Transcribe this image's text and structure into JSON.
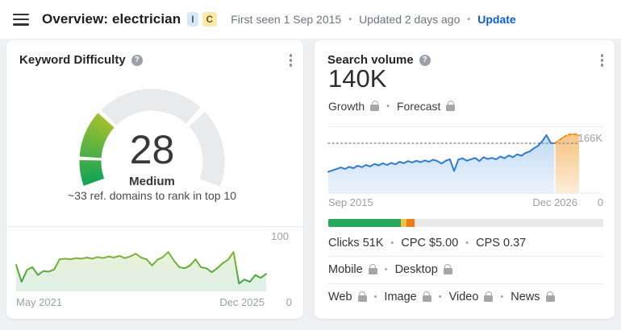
{
  "header": {
    "title": "Overview: electrician",
    "badge_i": "I",
    "badge_c": "C",
    "first_seen": "First seen 1 Sep 2015",
    "updated": "Updated 2 days ago",
    "update_link": "Update",
    "separator": "•"
  },
  "kd_card": {
    "title": "Keyword Difficulty",
    "help_icon": "?",
    "value": "28",
    "label": "Medium",
    "note": "~33 ref. domains to rank in top 10",
    "history": {
      "x_left": "May 2021",
      "x_right": "Dec 2025",
      "y_top": "100",
      "y_bottom": "0"
    }
  },
  "volume_card": {
    "title": "Search volume",
    "help_icon": "?",
    "value": "140K",
    "toggles": [
      {
        "label": "Growth",
        "locked": true
      },
      {
        "label": "Forecast",
        "locked": true
      }
    ],
    "axis": {
      "x_left": "Sep 2015",
      "x_right": "Dec 2026",
      "y_bottom": "0",
      "peak_label": "166K"
    },
    "bar": {
      "track_color": "#e9e9e9",
      "segments": [
        {
          "name": "organic-clicks",
          "color": "#27a65e",
          "pct": 26.4
        },
        {
          "name": "mixed-clicks",
          "color": "#f0c243",
          "pct": 2.0
        },
        {
          "name": "paid-clicks",
          "color": "#ef7d17",
          "pct": 2.9
        }
      ]
    },
    "rows": [
      {
        "name": "clicks-row",
        "items": [
          {
            "label": "Clicks 51K"
          },
          {
            "label": "CPC $5.00"
          },
          {
            "label": "CPS 0.37"
          }
        ]
      },
      {
        "name": "devices-row",
        "items": [
          {
            "label": "Mobile",
            "locked": true
          },
          {
            "label": "Desktop",
            "locked": true
          }
        ]
      },
      {
        "name": "platforms-row",
        "items": [
          {
            "label": "Web",
            "locked": true
          },
          {
            "label": "Image",
            "locked": true
          },
          {
            "label": "Video",
            "locked": true
          },
          {
            "label": "News",
            "locked": true
          }
        ]
      }
    ]
  },
  "chart_data": [
    {
      "id": "kd-gauge",
      "type": "gauge",
      "title": "Keyword Difficulty",
      "value": 28,
      "min": 0,
      "max": 100,
      "label": "Medium",
      "segment_boundaries": [
        10,
        30,
        70
      ],
      "sweep_deg": 220,
      "fill_color_start": "#14a457",
      "fill_color_end": "#a3c02c",
      "track_color": "#e9eaec"
    },
    {
      "id": "kd-history",
      "type": "area",
      "title": "Keyword Difficulty history",
      "x_range": [
        "May 2021",
        "Dec 2025"
      ],
      "ylim": [
        0,
        100
      ],
      "line_color_top": "#a8c12d",
      "line_color_bottom": "#2f9e44",
      "values": [
        47,
        17,
        38,
        43,
        29,
        36,
        35,
        39,
        57,
        58,
        57,
        59,
        58,
        60,
        58,
        61,
        59,
        62,
        60,
        63,
        59,
        62,
        67,
        60,
        57,
        46,
        56,
        61,
        70,
        55,
        43,
        41,
        46,
        57,
        43,
        41,
        34,
        41,
        50,
        56,
        70,
        14,
        21,
        17,
        29,
        24,
        31
      ]
    },
    {
      "id": "search-volume",
      "type": "area",
      "title": "Search volume history and forecast",
      "x_range": [
        "Sep 2015",
        "Dec 2026"
      ],
      "ylim": [
        0,
        185
      ],
      "unit": "K",
      "dotted_level": 140,
      "peak_label": "166K",
      "series": [
        {
          "name": "history",
          "color": "#2e7cd0",
          "values": [
            60,
            64,
            68,
            72,
            68,
            74,
            70,
            77,
            73,
            79,
            75,
            82,
            78,
            84,
            79,
            85,
            81,
            88,
            84,
            90,
            86,
            91,
            87,
            92,
            88,
            94,
            90,
            83,
            91,
            95,
            62,
            94,
            98,
            91,
            95,
            99,
            90,
            101,
            96,
            99,
            95,
            103,
            98,
            106,
            101,
            109,
            105,
            113,
            117,
            126,
            133,
            146,
            163,
            141,
            140
          ]
        },
        {
          "name": "forecast",
          "color": "#ee8a12",
          "dashed": true,
          "values": [
            140,
            147,
            154,
            160,
            164,
            166,
            165,
            162
          ]
        }
      ]
    }
  ]
}
